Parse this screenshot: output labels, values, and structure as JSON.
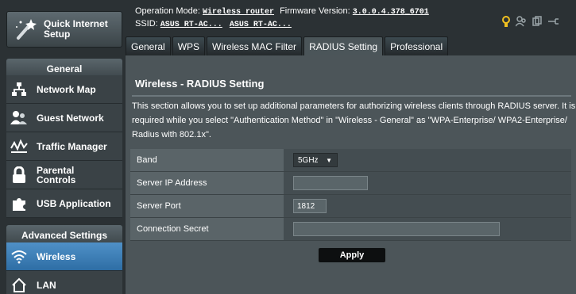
{
  "sidebar": {
    "quick_setup_label": "Quick Internet Setup",
    "general_header": "General",
    "general_items": [
      {
        "label": "Network Map",
        "icon": "network-map-icon"
      },
      {
        "label": "Guest Network",
        "icon": "guest-network-icon"
      },
      {
        "label": "Traffic Manager",
        "icon": "traffic-manager-icon"
      },
      {
        "label": "Parental Controls",
        "icon": "parental-controls-icon"
      },
      {
        "label": "USB Application",
        "icon": "usb-application-icon"
      }
    ],
    "advanced_header": "Advanced Settings",
    "advanced_items": [
      {
        "label": "Wireless",
        "icon": "wireless-icon",
        "active": true
      },
      {
        "label": "LAN",
        "icon": "lan-icon",
        "active": false
      }
    ]
  },
  "header": {
    "operation_mode_label": "Operation Mode:",
    "operation_mode_value": "Wireless router",
    "firmware_label": "Firmware Version:",
    "firmware_value": "3.0.0.4.378_6701",
    "ssid_label": "SSID:",
    "ssid_1": "ASUS RT-AC...",
    "ssid_2": "ASUS RT-AC..."
  },
  "tabs": [
    {
      "label": "General",
      "active": false
    },
    {
      "label": "WPS",
      "active": false
    },
    {
      "label": "Wireless MAC Filter",
      "active": false
    },
    {
      "label": "RADIUS Setting",
      "active": true
    },
    {
      "label": "Professional",
      "active": false
    }
  ],
  "panel": {
    "title": "Wireless - RADIUS Setting",
    "description": "This section allows you to set up additional parameters for authorizing wireless clients through RADIUS server. It is required while you select \"Authentication Method\" in \"Wireless - General\" as \"WPA-Enterprise/ WPA2-Enterprise/ Radius with 802.1x\".",
    "fields": {
      "band_label": "Band",
      "band_value": "5GHz",
      "server_ip_label": "Server IP Address",
      "server_ip_value": "",
      "server_port_label": "Server Port",
      "server_port_value": "1812",
      "secret_label": "Connection Secret",
      "secret_value": ""
    },
    "apply_label": "Apply"
  },
  "colors": {
    "accent": "#2e6ea5",
    "sidebar_bg": "#2b3134",
    "panel_bg": "#4c5559",
    "status_yellow": "#f0c020"
  }
}
